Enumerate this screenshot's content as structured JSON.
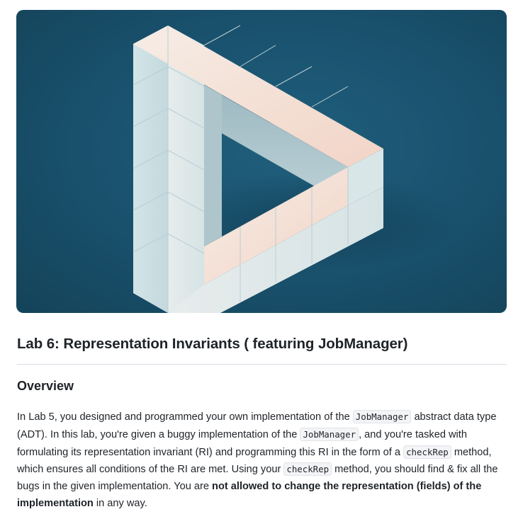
{
  "hero": {
    "alt": "Impossible triangle of pastel cubes on a teal background"
  },
  "article": {
    "title": "Lab 6: Representation Invariants ( featuring JobManager)",
    "overview_heading": "Overview",
    "paragraph": {
      "t1": "In Lab 5, you designed and programmed your own implementation of the ",
      "c1": "JobManager",
      "t2": " abstract data type (ADT). In this lab, you're given a buggy implementation of the ",
      "c2": "JobManager",
      "t3": ", and you're tasked with formulating its representation invariant (RI) and programming this RI in the form of a ",
      "c3": "checkRep",
      "t4": " method, which ensures all conditions of the RI are met.  Using your ",
      "c4": "checkRep",
      "t5": " method, you should find & fix all the bugs in the given implementation. You are ",
      "b1": "not allowed to change the representation (fields) of the implementation",
      "t6": " in any way."
    }
  },
  "colors": {
    "background_teal": "#1a5370",
    "cube_light": "#f4e6dc",
    "cube_blue": "#cfe1e4",
    "cube_peach": "#f2cdbd"
  }
}
